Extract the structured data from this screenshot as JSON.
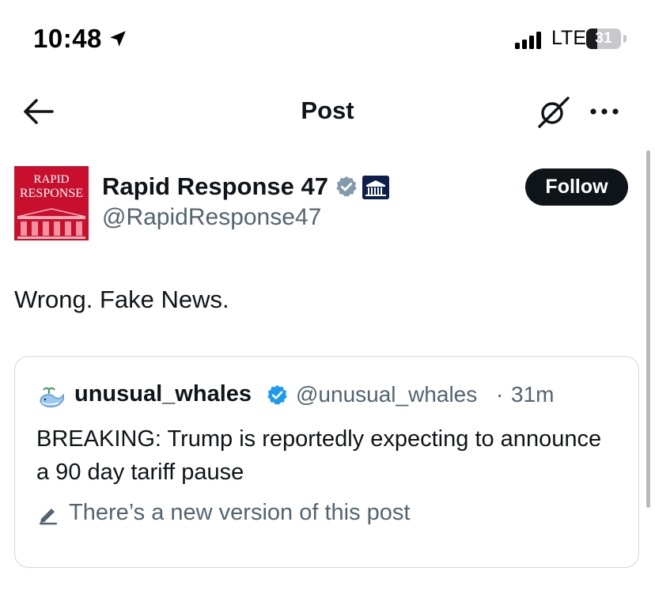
{
  "status_bar": {
    "time": "10:48",
    "network": "LTE",
    "battery": "31"
  },
  "header": {
    "title": "Post",
    "icons": [
      "back-arrow-icon",
      "grok-icon",
      "more-icon"
    ]
  },
  "post": {
    "author": {
      "avatar_line1": "RAPID",
      "avatar_line2": "RESPONSE",
      "display_name": "Rapid Response 47",
      "handle": "@RapidResponse47"
    },
    "follow_label": "Follow",
    "text": "Wrong. Fake News."
  },
  "quoted_post": {
    "display_name": "unusual_whales",
    "handle": "@unusual_whales",
    "separator": "·",
    "time": "31m",
    "text": "BREAKING: Trump is reportedly expecting to announce a 90 day tariff pause",
    "edit_notice": "There’s a new version of this post"
  },
  "colors": {
    "text_primary": "#0f1419",
    "text_secondary": "#536471",
    "verified_blue": "#1d9bf0",
    "verified_gray": "#829aab",
    "avatar_red": "#c8102e",
    "border": "#cfd9de"
  }
}
